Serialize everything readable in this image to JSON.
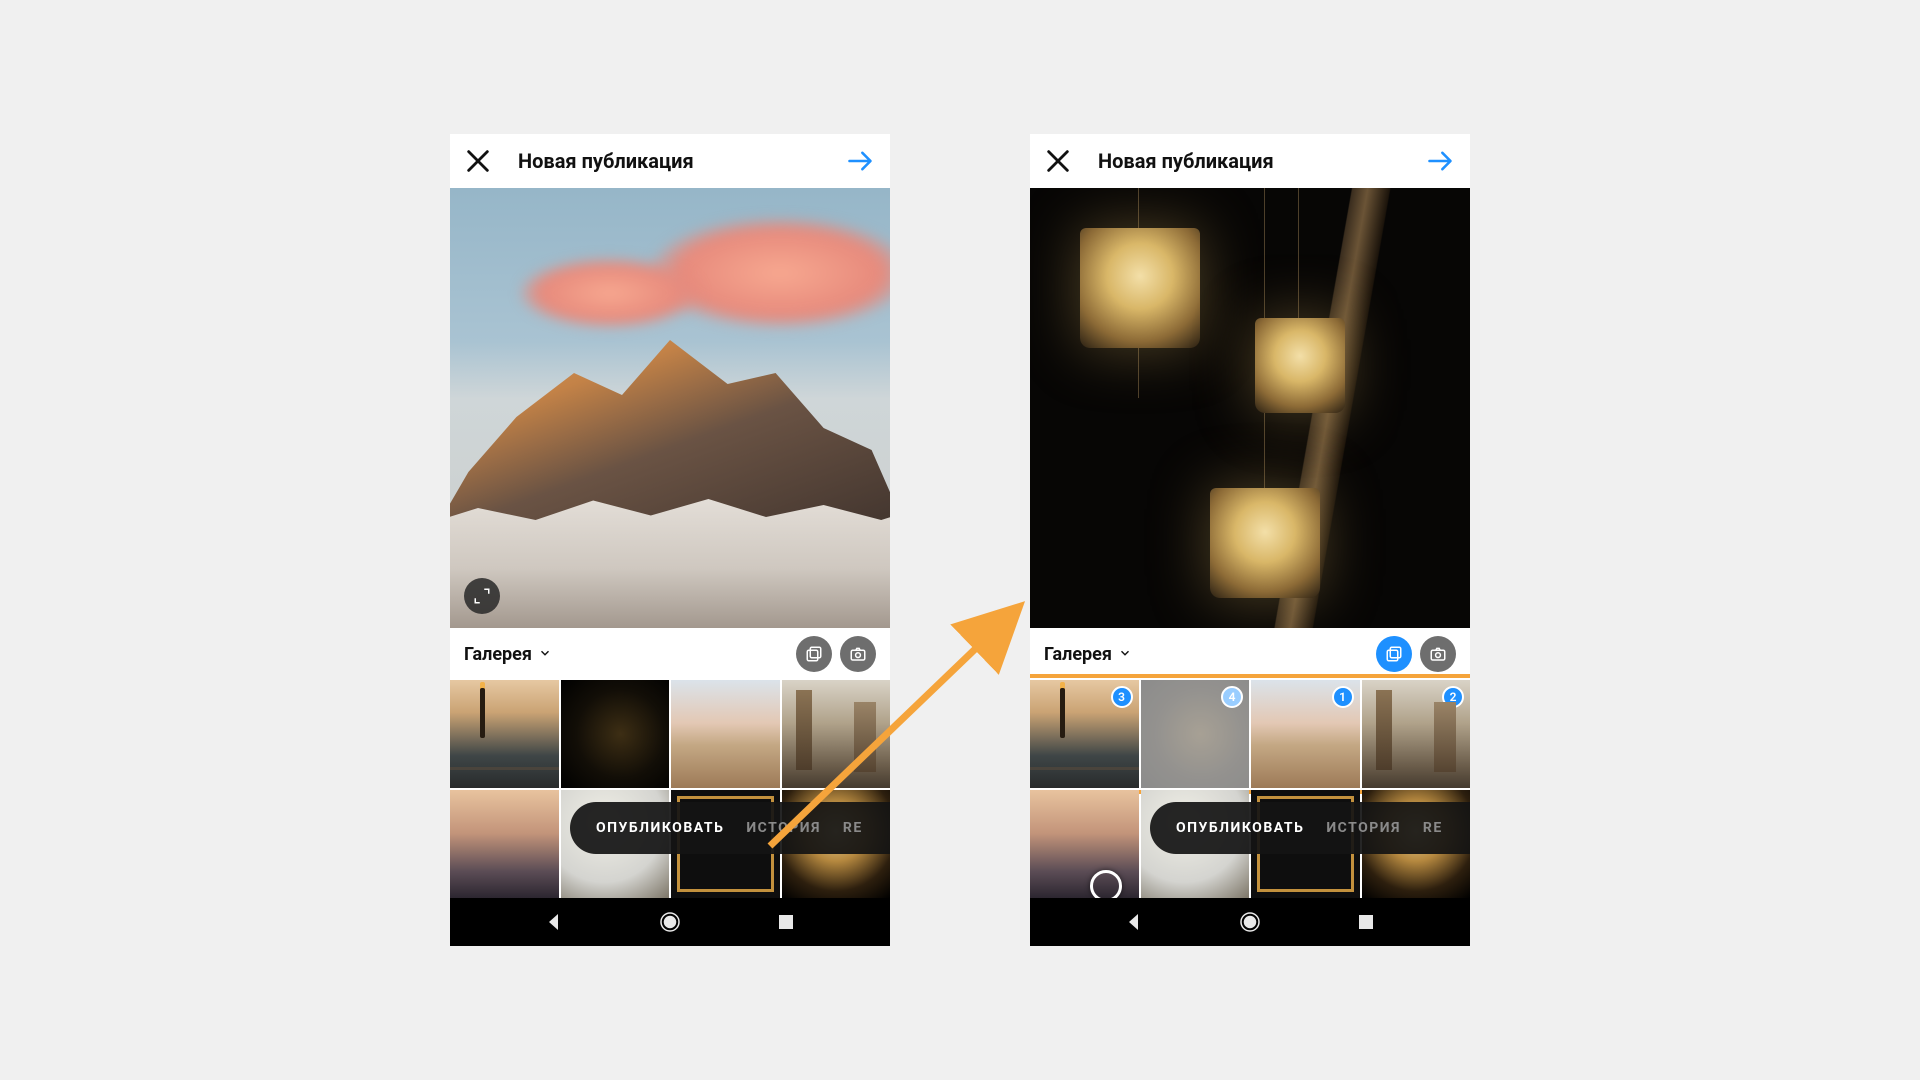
{
  "header": {
    "title": "Новая публикация"
  },
  "gallery": {
    "label": "Галерея",
    "tabs": {
      "publish": "ОПУБЛИКОВАТЬ",
      "story": "ИСТОРИЯ",
      "reels_partial": "RE"
    }
  },
  "screen2": {
    "selection": {
      "thumb1": "3",
      "thumb2": "4",
      "thumb3": "1",
      "thumb4": "2"
    }
  },
  "colors": {
    "accent": "#1e90ff",
    "highlight": "#f5a43b"
  }
}
